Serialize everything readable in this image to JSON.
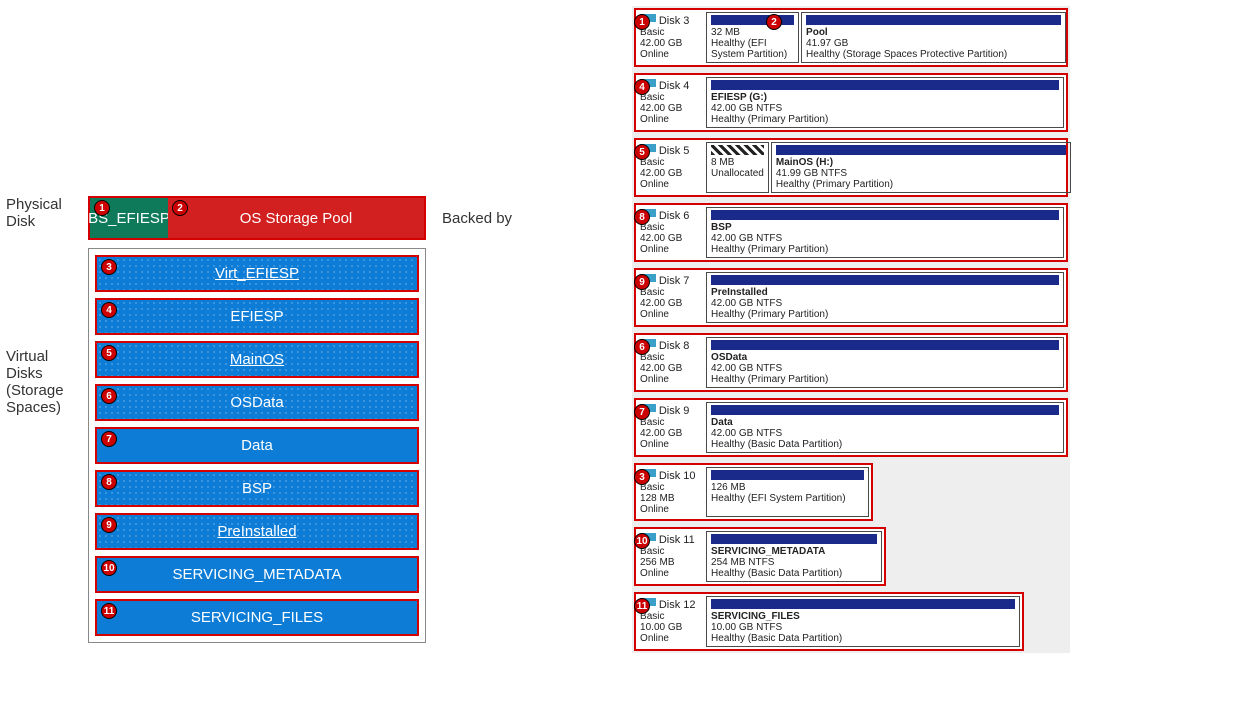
{
  "leftLabels": {
    "physical": "Physical Disk",
    "virtual": "Virtual Disks (Storage Spaces)",
    "backed": "Backed by"
  },
  "phys": {
    "p1": {
      "n": "1",
      "t": "BS_EFIESP"
    },
    "p2": {
      "n": "2",
      "t": "OS Storage Pool"
    }
  },
  "vd": [
    {
      "n": "3",
      "t": "Virt_EFIESP",
      "dotted": true,
      "link": true
    },
    {
      "n": "4",
      "t": "EFIESP",
      "dotted": true
    },
    {
      "n": "5",
      "t": "MainOS",
      "dotted": true,
      "link": true
    },
    {
      "n": "6",
      "t": "OSData",
      "dotted": true
    },
    {
      "n": "7",
      "t": "Data"
    },
    {
      "n": "8",
      "t": "BSP",
      "dotted": true
    },
    {
      "n": "9",
      "t": "PreInstalled",
      "dotted": true,
      "link": true
    },
    {
      "n": "10",
      "t": "SERVICING_METADATA"
    },
    {
      "n": "11",
      "t": "SERVICING_FILES"
    }
  ],
  "disks": [
    {
      "name": "Disk 3",
      "type": "Basic",
      "size": "42.00 GB",
      "state": "Online",
      "badges": [
        "1",
        "2"
      ],
      "parts": [
        {
          "title": "",
          "sub": "32 MB",
          "stat": "Healthy (EFI System Partition)",
          "w": "26"
        },
        {
          "title": "Pool",
          "sub": "41.97 GB",
          "stat": "Healthy (Storage Spaces Protective Partition)",
          "w": "74"
        }
      ]
    },
    {
      "name": "Disk 4",
      "type": "Basic",
      "size": "42.00 GB",
      "state": "Online",
      "badges": [
        "4"
      ],
      "parts": [
        {
          "title": "EFIESP  (G:)",
          "sub": "42.00 GB NTFS",
          "stat": "Healthy (Primary Partition)",
          "w": "100"
        }
      ]
    },
    {
      "name": "Disk 5",
      "type": "Basic",
      "size": "42.00 GB",
      "state": "Online",
      "badges": [
        "5"
      ],
      "parts": [
        {
          "title": "",
          "sub": "8 MB",
          "stat": "Unallocated",
          "w": "16",
          "un": true
        },
        {
          "title": "MainOS  (H:)",
          "sub": "41.99 GB NTFS",
          "stat": "Healthy (Primary Partition)",
          "w": "84"
        }
      ]
    },
    {
      "name": "Disk 6",
      "type": "Basic",
      "size": "42.00 GB",
      "state": "Online",
      "badges": [
        "8"
      ],
      "parts": [
        {
          "title": "BSP",
          "sub": "42.00 GB NTFS",
          "stat": "Healthy (Primary Partition)",
          "w": "100"
        }
      ]
    },
    {
      "name": "Disk 7",
      "type": "Basic",
      "size": "42.00 GB",
      "state": "Online",
      "badges": [
        "9"
      ],
      "parts": [
        {
          "title": "PreInstalled",
          "sub": "42.00 GB NTFS",
          "stat": "Healthy (Primary Partition)",
          "w": "100"
        }
      ]
    },
    {
      "name": "Disk 8",
      "type": "Basic",
      "size": "42.00 GB",
      "state": "Online",
      "badges": [
        "6"
      ],
      "parts": [
        {
          "title": "OSData",
          "sub": "42.00 GB NTFS",
          "stat": "Healthy (Primary Partition)",
          "w": "100"
        }
      ]
    },
    {
      "name": "Disk 9",
      "type": "Basic",
      "size": "42.00 GB",
      "state": "Online",
      "badges": [
        "7"
      ],
      "parts": [
        {
          "title": "Data",
          "sub": "42.00 GB NTFS",
          "stat": "Healthy (Basic Data Partition)",
          "w": "100"
        }
      ]
    },
    {
      "name": "Disk 10",
      "type": "Basic",
      "size": "128 MB",
      "state": "Online",
      "badges": [
        "3"
      ],
      "width": "55",
      "parts": [
        {
          "title": "",
          "sub": "126 MB",
          "stat": "Healthy (EFI System Partition)",
          "w": "100"
        }
      ]
    },
    {
      "name": "Disk 11",
      "type": "Basic",
      "size": "256 MB",
      "state": "Online",
      "badges": [
        "10"
      ],
      "width": "58",
      "parts": [
        {
          "title": "SERVICING_METADATA",
          "sub": "254 MB NTFS",
          "stat": "Healthy (Basic Data Partition)",
          "w": "100"
        }
      ]
    },
    {
      "name": "Disk 12",
      "type": "Basic",
      "size": "10.00 GB",
      "state": "Online",
      "badges": [
        "11"
      ],
      "width": "90",
      "parts": [
        {
          "title": "SERVICING_FILES",
          "sub": "10.00 GB NTFS",
          "stat": "Healthy (Basic Data Partition)",
          "w": "100"
        }
      ]
    }
  ]
}
